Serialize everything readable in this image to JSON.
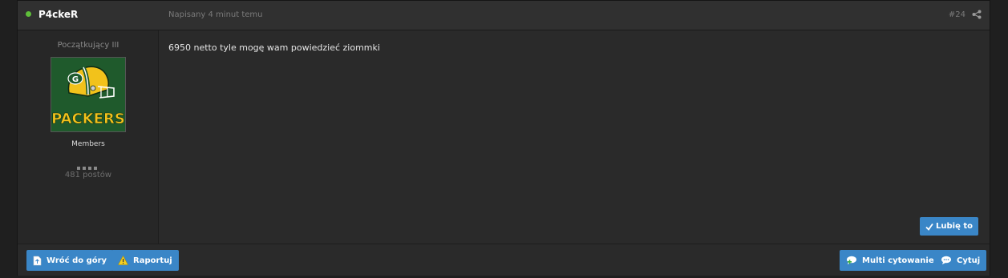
{
  "post": {
    "author": "P4ckeR",
    "posted_text": "Napisany 4 minut temu",
    "post_number": "#24",
    "content": "6950 netto tyle mogę wam powiedzieć ziommki"
  },
  "author_info": {
    "rank": "Początkujący III",
    "group": "Members",
    "post_count": "481 postów",
    "avatar_text": "PACKERS",
    "avatar_monogram": "G"
  },
  "actions": {
    "like_label": "Lubię to",
    "back_to_top_label": "Wróć do góry",
    "report_label": "Raportuj",
    "multi_quote_label": "Multi cytowanie",
    "quote_label": "Cytuj"
  },
  "colors": {
    "accent": "#3a86c7",
    "online": "#5fbf3a",
    "avatar_green": "#1f5a2c",
    "avatar_yellow": "#f2c21b"
  },
  "icons": {
    "online": "online-dot-icon",
    "share": "share-icon",
    "check": "check-icon",
    "page": "page-icon",
    "warning": "warning-icon",
    "multi_quote": "speech-bubble-plus-icon",
    "quote": "speech-bubble-icon"
  }
}
